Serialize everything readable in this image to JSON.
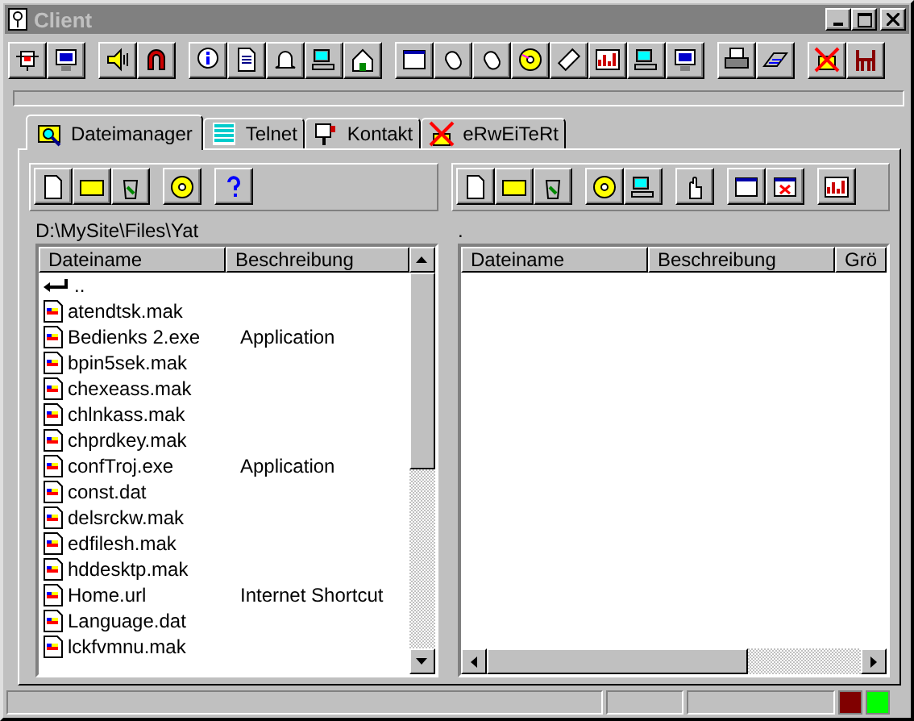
{
  "window": {
    "title": "Client"
  },
  "tabs": [
    {
      "label": "Dateimanager",
      "selected": true
    },
    {
      "label": "Telnet",
      "selected": false
    },
    {
      "label": "Kontakt",
      "selected": false
    },
    {
      "label": "eRwEiTeRt",
      "selected": false
    }
  ],
  "left_pane": {
    "path": "D:\\MySite\\Files\\Yat",
    "columns": [
      "Dateiname",
      "Beschreibung"
    ],
    "rows": [
      {
        "kind": "parent",
        "name": "..",
        "description": ""
      },
      {
        "kind": "file",
        "name": "atendtsk.mak",
        "description": ""
      },
      {
        "kind": "file",
        "name": "Bedienks 2.exe",
        "description": "Application"
      },
      {
        "kind": "file",
        "name": "bpin5sek.mak",
        "description": ""
      },
      {
        "kind": "file",
        "name": "chexeass.mak",
        "description": ""
      },
      {
        "kind": "file",
        "name": "chlnkass.mak",
        "description": ""
      },
      {
        "kind": "file",
        "name": "chprdkey.mak",
        "description": ""
      },
      {
        "kind": "file",
        "name": "confTroj.exe",
        "description": "Application"
      },
      {
        "kind": "file",
        "name": "const.dat",
        "description": ""
      },
      {
        "kind": "file",
        "name": "delsrckw.mak",
        "description": ""
      },
      {
        "kind": "file",
        "name": "edfilesh.mak",
        "description": ""
      },
      {
        "kind": "file",
        "name": "hddesktp.mak",
        "description": ""
      },
      {
        "kind": "file",
        "name": "Home.url",
        "description": "Internet Shortcut"
      },
      {
        "kind": "file",
        "name": "Language.dat",
        "description": ""
      },
      {
        "kind": "file",
        "name": "lckfvmnu.mak",
        "description": ""
      }
    ]
  },
  "right_pane": {
    "path": ".",
    "columns": [
      "Dateiname",
      "Beschreibung",
      "Grö"
    ]
  },
  "status_bar": {
    "indicators": [
      {
        "color": "#800000"
      },
      {
        "color": "#00ff00"
      }
    ]
  }
}
